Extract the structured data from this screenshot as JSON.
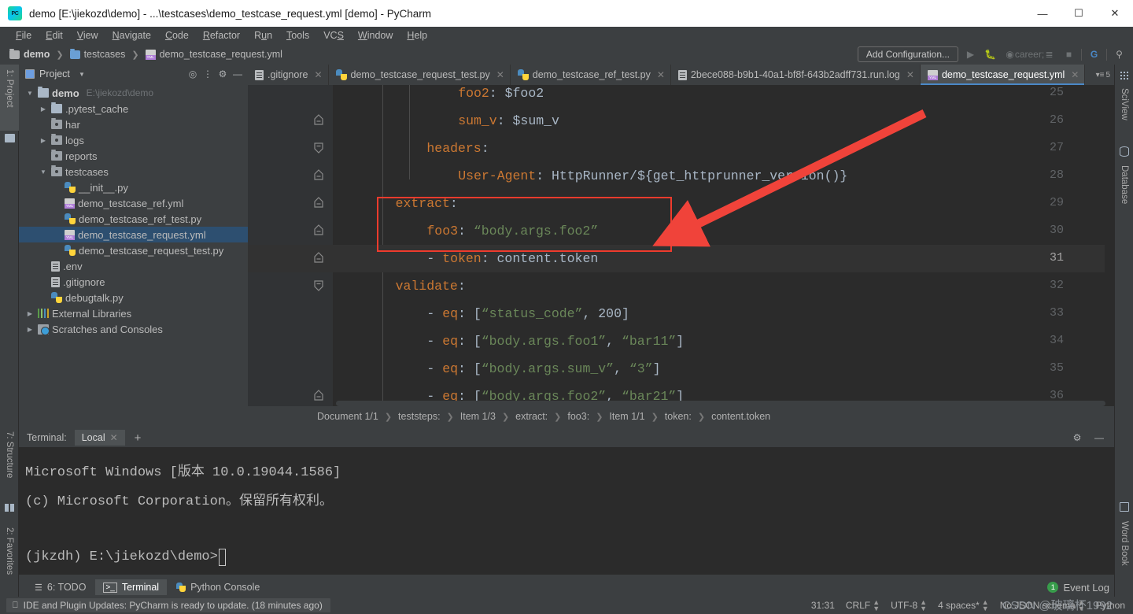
{
  "window": {
    "title": "demo [E:\\jiekozd\\demo] - ...\\testcases\\demo_testcase_request.yml [demo] - PyCharm",
    "minimize": "—",
    "maximize": "☐",
    "close": "✕"
  },
  "menu": [
    {
      "label": "File"
    },
    {
      "label": "Edit"
    },
    {
      "label": "View"
    },
    {
      "label": "Navigate"
    },
    {
      "label": "Code"
    },
    {
      "label": "Refactor"
    },
    {
      "label": "Run"
    },
    {
      "label": "Tools"
    },
    {
      "label": "VCS"
    },
    {
      "label": "Window"
    },
    {
      "label": "Help"
    }
  ],
  "navbar": {
    "crumbs": [
      "demo",
      "testcases",
      "demo_testcase_request.yml"
    ],
    "add_configuration": "Add Configuration..."
  },
  "left_strip": [
    {
      "label": "1: Project",
      "icon": "folder-icon",
      "selected": true
    },
    {
      "label": "7: Structure",
      "icon": "structure-icon",
      "selected": false
    },
    {
      "label": "2: Favorites",
      "icon": "star-icon",
      "selected": false
    }
  ],
  "right_strip": [
    {
      "label": "SciView",
      "icon": "grid-icon"
    },
    {
      "label": "Database",
      "icon": "database-icon"
    },
    {
      "label": "Word Book",
      "icon": "book-icon"
    }
  ],
  "project": {
    "title": "Project",
    "tree": [
      {
        "depth": 0,
        "arrow": "down",
        "icon": "folder-icon",
        "label": "demo",
        "bold": true,
        "path": "E:\\jiekozd\\demo",
        "selected": false
      },
      {
        "depth": 1,
        "arrow": "right",
        "icon": "folder-icon",
        "label": ".pytest_cache",
        "bold": false,
        "path": "",
        "selected": false
      },
      {
        "depth": 1,
        "arrow": "none",
        "icon": "folder-dot-icon",
        "label": "har",
        "bold": false,
        "path": "",
        "selected": false
      },
      {
        "depth": 1,
        "arrow": "right",
        "icon": "folder-dot-icon",
        "label": "logs",
        "bold": false,
        "path": "",
        "selected": false
      },
      {
        "depth": 1,
        "arrow": "none",
        "icon": "folder-dot-icon",
        "label": "reports",
        "bold": false,
        "path": "",
        "selected": false
      },
      {
        "depth": 1,
        "arrow": "down",
        "icon": "folder-dot-icon",
        "label": "testcases",
        "bold": false,
        "path": "",
        "selected": false
      },
      {
        "depth": 2,
        "arrow": "none",
        "icon": "python-icon",
        "label": "__init__.py",
        "bold": false,
        "path": "",
        "selected": false
      },
      {
        "depth": 2,
        "arrow": "none",
        "icon": "yaml-icon",
        "label": "demo_testcase_ref.yml",
        "bold": false,
        "path": "",
        "selected": false
      },
      {
        "depth": 2,
        "arrow": "none",
        "icon": "python-icon",
        "label": "demo_testcase_ref_test.py",
        "bold": false,
        "path": "",
        "selected": false
      },
      {
        "depth": 2,
        "arrow": "none",
        "icon": "yaml-icon",
        "label": "demo_testcase_request.yml",
        "bold": false,
        "path": "",
        "selected": true
      },
      {
        "depth": 2,
        "arrow": "none",
        "icon": "python-icon",
        "label": "demo_testcase_request_test.py",
        "bold": false,
        "path": "",
        "selected": false
      },
      {
        "depth": 1,
        "arrow": "none",
        "icon": "file-icon",
        "label": ".env",
        "bold": false,
        "path": "",
        "selected": false
      },
      {
        "depth": 1,
        "arrow": "none",
        "icon": "file-icon",
        "label": ".gitignore",
        "bold": false,
        "path": "",
        "selected": false
      },
      {
        "depth": 1,
        "arrow": "none",
        "icon": "python-icon",
        "label": "debugtalk.py",
        "bold": false,
        "path": "",
        "selected": false
      },
      {
        "depth": 0,
        "arrow": "right",
        "icon": "library-icon",
        "label": "External Libraries",
        "bold": false,
        "path": "",
        "selected": false
      },
      {
        "depth": 0,
        "arrow": "right",
        "icon": "scratches-icon",
        "label": "Scratches and Consoles",
        "bold": false,
        "path": "",
        "selected": false
      }
    ]
  },
  "editor": {
    "tabs": [
      {
        "label": ".gitignore",
        "icon": "file-icon",
        "active": false
      },
      {
        "label": "demo_testcase_request_test.py",
        "icon": "python-icon",
        "active": false
      },
      {
        "label": "demo_testcase_ref_test.py",
        "icon": "python-icon",
        "active": false
      },
      {
        "label": "2bece088-b9b1-40a1-bf8f-643b2adff731.run.log",
        "icon": "file-icon",
        "active": false
      },
      {
        "label": "demo_testcase_request.yml",
        "icon": "yaml-icon",
        "active": true
      }
    ],
    "tab_overflow": "5",
    "lines": [
      {
        "num": "25",
        "fold": "none",
        "indent": 16,
        "tokens": [
          {
            "t": "foo2",
            "c": "k"
          },
          {
            "t": ": ",
            "c": "p"
          },
          {
            "t": "$foo2",
            "c": "v"
          }
        ]
      },
      {
        "num": "26",
        "fold": "collapse",
        "indent": 16,
        "tokens": [
          {
            "t": "sum_v",
            "c": "k"
          },
          {
            "t": ": ",
            "c": "p"
          },
          {
            "t": "$sum_v",
            "c": "v"
          }
        ]
      },
      {
        "num": "27",
        "fold": "end",
        "indent": 12,
        "tokens": [
          {
            "t": "headers",
            "c": "k"
          },
          {
            "t": ":",
            "c": "p"
          }
        ]
      },
      {
        "num": "28",
        "fold": "collapse",
        "indent": 16,
        "tokens": [
          {
            "t": "User-Agent",
            "c": "k"
          },
          {
            "t": ": ",
            "c": "p"
          },
          {
            "t": "HttpRunner/${get_httprunner_version()}",
            "c": "v"
          }
        ]
      },
      {
        "num": "29",
        "fold": "collapse",
        "indent": 8,
        "tokens": [
          {
            "t": "extract",
            "c": "k"
          },
          {
            "t": ":",
            "c": "p"
          }
        ]
      },
      {
        "num": "30",
        "fold": "collapse",
        "indent": 12,
        "tokens": [
          {
            "t": "foo3",
            "c": "k"
          },
          {
            "t": ": ",
            "c": "p"
          },
          {
            "t": "“body.args.foo2”",
            "c": "s"
          }
        ]
      },
      {
        "num": "31",
        "fold": "collapse",
        "indent": 12,
        "current": true,
        "tokens": [
          {
            "t": "- ",
            "c": "v"
          },
          {
            "t": "token",
            "c": "k"
          },
          {
            "t": ": ",
            "c": "p"
          },
          {
            "t": "content.token",
            "c": "v"
          }
        ]
      },
      {
        "num": "32",
        "fold": "end",
        "indent": 8,
        "tokens": [
          {
            "t": "validate",
            "c": "k"
          },
          {
            "t": ":",
            "c": "p"
          }
        ]
      },
      {
        "num": "33",
        "fold": "none",
        "indent": 12,
        "tokens": [
          {
            "t": "- ",
            "c": "v"
          },
          {
            "t": "eq",
            "c": "k"
          },
          {
            "t": ": ",
            "c": "p"
          },
          {
            "t": "[",
            "c": "p"
          },
          {
            "t": "“status_code”",
            "c": "s"
          },
          {
            "t": ", ",
            "c": "p"
          },
          {
            "t": "200",
            "c": "n"
          },
          {
            "t": "]",
            "c": "p"
          }
        ]
      },
      {
        "num": "34",
        "fold": "none",
        "indent": 12,
        "tokens": [
          {
            "t": "- ",
            "c": "v"
          },
          {
            "t": "eq",
            "c": "k"
          },
          {
            "t": ": ",
            "c": "p"
          },
          {
            "t": "[",
            "c": "p"
          },
          {
            "t": "“body.args.foo1”",
            "c": "s"
          },
          {
            "t": ", ",
            "c": "p"
          },
          {
            "t": "“bar11”",
            "c": "s"
          },
          {
            "t": "]",
            "c": "p"
          }
        ]
      },
      {
        "num": "35",
        "fold": "none",
        "indent": 12,
        "tokens": [
          {
            "t": "- ",
            "c": "v"
          },
          {
            "t": "eq",
            "c": "k"
          },
          {
            "t": ": ",
            "c": "p"
          },
          {
            "t": "[",
            "c": "p"
          },
          {
            "t": "“body.args.sum_v”",
            "c": "s"
          },
          {
            "t": ", ",
            "c": "p"
          },
          {
            "t": "“3”",
            "c": "s"
          },
          {
            "t": "]",
            "c": "p"
          }
        ]
      },
      {
        "num": "36",
        "fold": "collapse",
        "indent": 12,
        "tokens": [
          {
            "t": "- ",
            "c": "v"
          },
          {
            "t": "eq",
            "c": "k"
          },
          {
            "t": ": ",
            "c": "p"
          },
          {
            "t": "[",
            "c": "p"
          },
          {
            "t": "“body.args.foo2”",
            "c": "s"
          },
          {
            "t": ", ",
            "c": "p"
          },
          {
            "t": "“bar21”",
            "c": "s"
          },
          {
            "t": "]",
            "c": "p"
          }
        ]
      }
    ],
    "breadcrumb": [
      "Document 1/1",
      "teststeps:",
      "Item 1/3",
      "extract:",
      "foo3:",
      "Item 1/1",
      "token:",
      "content.token"
    ],
    "annotation_color": "#ef3b2d"
  },
  "terminal": {
    "label": "Terminal:",
    "tab": "Local",
    "add": "+",
    "lines": [
      "Microsoft Windows [版本 10.0.19044.1586]",
      "(c) Microsoft Corporation。保留所有权利。",
      "",
      "(jkzdh) E:\\jiekozd\\demo>"
    ]
  },
  "toolwindow_bar": {
    "items": [
      {
        "label": "6: TODO",
        "icon": "todo-icon",
        "selected": false
      },
      {
        "label": "Terminal",
        "icon": "terminal-icon",
        "selected": true
      },
      {
        "label": "Python Console",
        "icon": "python-icon",
        "selected": false
      }
    ],
    "event_log": {
      "count": "1",
      "label": "Event Log"
    }
  },
  "statusbar": {
    "message": "IDE and Plugin Updates: PyCharm is ready to update. (18 minutes ago)",
    "caret": "31:31",
    "line_sep": "CRLF",
    "encoding": "UTF-8",
    "indent": "4 spaces*",
    "schema": "No JSON schema",
    "branch": "Python"
  },
  "watermark": "CSDN @玻璃杯1992"
}
